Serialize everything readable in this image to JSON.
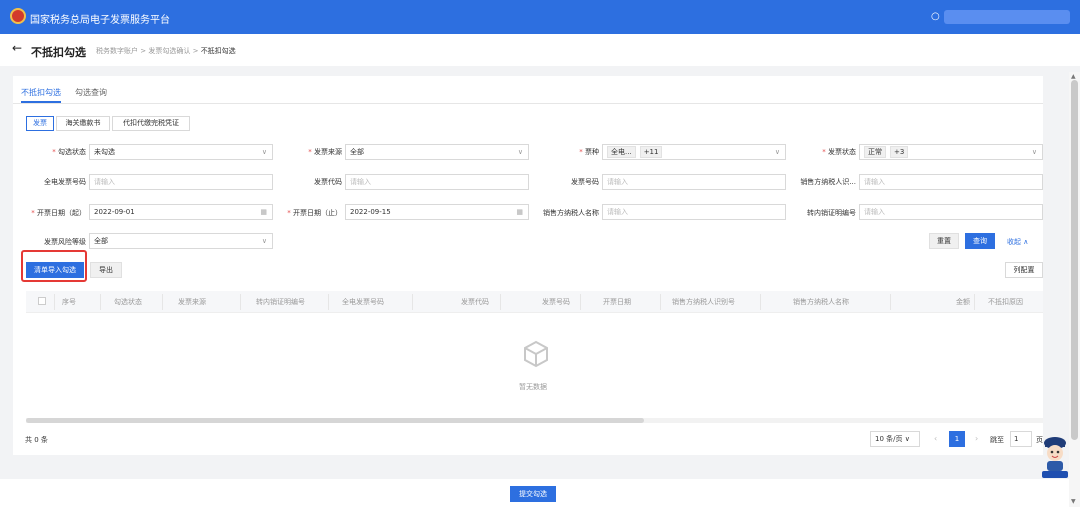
{
  "header": {
    "app_title": "国家税务总局电子发票服务平台",
    "user_icon": "user-icon"
  },
  "page": {
    "title": "不抵扣勾选",
    "breadcrumb": [
      "税务数字账户",
      "发票勾选确认",
      "不抵扣勾选"
    ],
    "breadcrumb_sep": ">"
  },
  "tabs": [
    "不抵扣勾选",
    "勾选查询"
  ],
  "segments": [
    "发票",
    "海关缴款书",
    "代扣代缴完税凭证"
  ],
  "filters": {
    "check_status": {
      "label": "勾选状态",
      "value": "未勾选"
    },
    "invoice_source": {
      "label": "发票来源",
      "value": "全部"
    },
    "ticket_type": {
      "label": "票种",
      "tag": "全电...",
      "more": "+11"
    },
    "invoice_status": {
      "label": "发票状态",
      "tag": "正常",
      "more": "+3"
    },
    "full_invoice_no": {
      "label": "全电发票号码",
      "placeholder": "请输入"
    },
    "invoice_code": {
      "label": "发票代码",
      "placeholder": "请输入"
    },
    "invoice_no": {
      "label": "发票号码",
      "placeholder": "请输入"
    },
    "seller_tax_id": {
      "label": "销售方纳税人识...",
      "placeholder": "请输入"
    },
    "date_start": {
      "label": "开票日期（起）",
      "value": "2022-09-01"
    },
    "date_end": {
      "label": "开票日期（止）",
      "value": "2022-09-15"
    },
    "seller_name": {
      "label": "销售方纳税人名称",
      "placeholder": "请输入"
    },
    "transfer_cert_no": {
      "label": "转内销证明编号",
      "placeholder": "请输入"
    },
    "risk_level": {
      "label": "发票风险等级",
      "value": "全部"
    }
  },
  "actions": {
    "reset": "重置",
    "query": "查询",
    "collapse": "收起",
    "import_check": "清单导入勾选",
    "export": "导出",
    "column_config": "列配置"
  },
  "table": {
    "columns": [
      "序号",
      "勾选状态",
      "发票来源",
      "转内销证明编号",
      "全电发票号码",
      "发票代码",
      "发票号码",
      "开票日期",
      "销售方纳税人识别号",
      "销售方纳税人名称",
      "金额",
      "不抵扣原因"
    ],
    "empty_text": "暂无数据"
  },
  "pagination": {
    "total": "共 0 条",
    "page_size": "10 条/页",
    "current": "1",
    "goto_label": "跳至",
    "goto_value": "1",
    "page_suffix": "页"
  },
  "footer": {
    "submit": "提交勾选"
  },
  "colors": {
    "primary": "#2d6fe0",
    "highlight": "#e53935",
    "required": "#e34d4d"
  }
}
